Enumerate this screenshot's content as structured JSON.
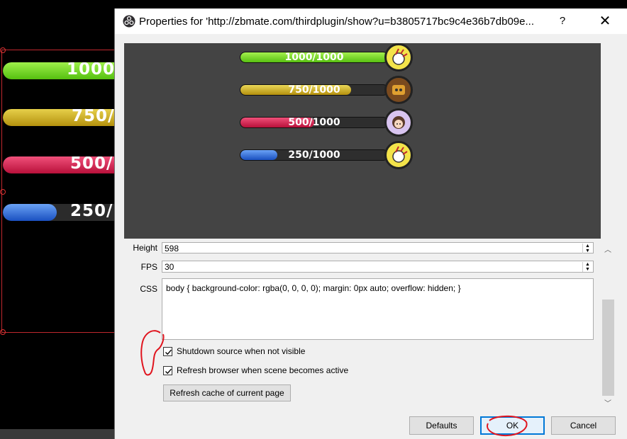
{
  "background": {
    "bars": [
      {
        "label": "1000/",
        "fill_fraction": 1.0,
        "color": "#6fe01a"
      },
      {
        "label": "750/",
        "fill_fraction": 0.75,
        "color": "#d5b21e"
      },
      {
        "label": "500/",
        "fill_fraction": 0.5,
        "color": "#d8224e"
      },
      {
        "label": "250/",
        "fill_fraction": 0.25,
        "color": "#2a6ee0"
      }
    ]
  },
  "dialog": {
    "title": "Properties for 'http://zbmate.com/thirdplugin/show?u=b3805717bc9c4e36b7db09e...",
    "help_label": "?",
    "close_label": "✕",
    "preview": {
      "bars": [
        {
          "label": "1000/1000",
          "fill_fraction": 1.0,
          "color": "#6fd31a"
        },
        {
          "label": "750/1000",
          "fill_fraction": 0.75,
          "color": "#d1ae1c"
        },
        {
          "label": "500/1000",
          "fill_fraction": 0.5,
          "color": "#d21d4a"
        },
        {
          "label": "250/1000",
          "fill_fraction": 0.25,
          "color": "#2267d8"
        }
      ]
    },
    "properties": {
      "height_label": "Height",
      "height_value": "598",
      "fps_label": "FPS",
      "fps_value": "30",
      "css_label": "CSS",
      "css_value": "body { background-color: rgba(0, 0, 0, 0); margin: 0px auto; overflow: hidden; }",
      "shutdown_label": "Shutdown source when not visible",
      "shutdown_checked": true,
      "refresh_label": "Refresh browser when scene becomes active",
      "refresh_checked": true,
      "refresh_cache_label": "Refresh cache of current page"
    },
    "buttons": {
      "defaults": "Defaults",
      "ok": "OK",
      "cancel": "Cancel"
    }
  },
  "colors": {
    "annotation": "#e0141e",
    "ok_focus": "#0078d7"
  }
}
